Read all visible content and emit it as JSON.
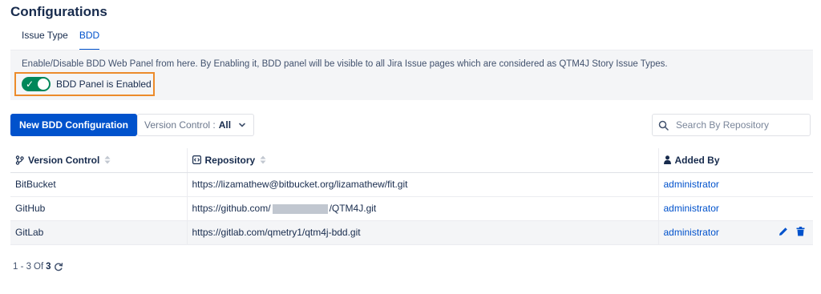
{
  "page": {
    "title": "Configurations"
  },
  "tabs": [
    {
      "label": "Issue Type",
      "active": false
    },
    {
      "label": "BDD",
      "active": true
    }
  ],
  "bdd_panel": {
    "description": "Enable/Disable BDD Web Panel from here. By Enabling it, BDD panel will be visible to all Jira Issue pages which are considered as QTM4J Story Issue Types.",
    "toggle_label": "BDD Panel is Enabled",
    "enabled": true
  },
  "toolbar": {
    "new_button_label": "New BDD Configuration",
    "version_control_label": "Version Control :",
    "version_control_value": "All",
    "search_placeholder": "Search By Repository"
  },
  "table": {
    "columns": [
      "Version Control",
      "Repository",
      "Added By"
    ],
    "rows": [
      {
        "version_control": "BitBucket",
        "repository": "https://lizamathew@bitbucket.org/lizamathew/fit.git",
        "added_by": "administrator"
      },
      {
        "version_control": "GitHub",
        "repository_prefix": "https://github.com/",
        "repository_suffix": "/QTM4J.git",
        "added_by": "administrator"
      },
      {
        "version_control": "GitLab",
        "repository": "https://gitlab.com/qmetry1/qtm4j-bdd.git",
        "added_by": "administrator"
      }
    ]
  },
  "pagination": {
    "range": "1 - 3",
    "of_label": "Of",
    "total": "3"
  },
  "colors": {
    "primary": "#0052cc",
    "toggle_on": "#00875a",
    "highlight_border": "#ec8b2b"
  },
  "icons": [
    "git-branch-icon",
    "code-icon",
    "user-icon",
    "sort-icon",
    "chevron-down-icon",
    "search-icon",
    "edit-icon",
    "trash-icon",
    "refresh-icon",
    "check-icon"
  ]
}
